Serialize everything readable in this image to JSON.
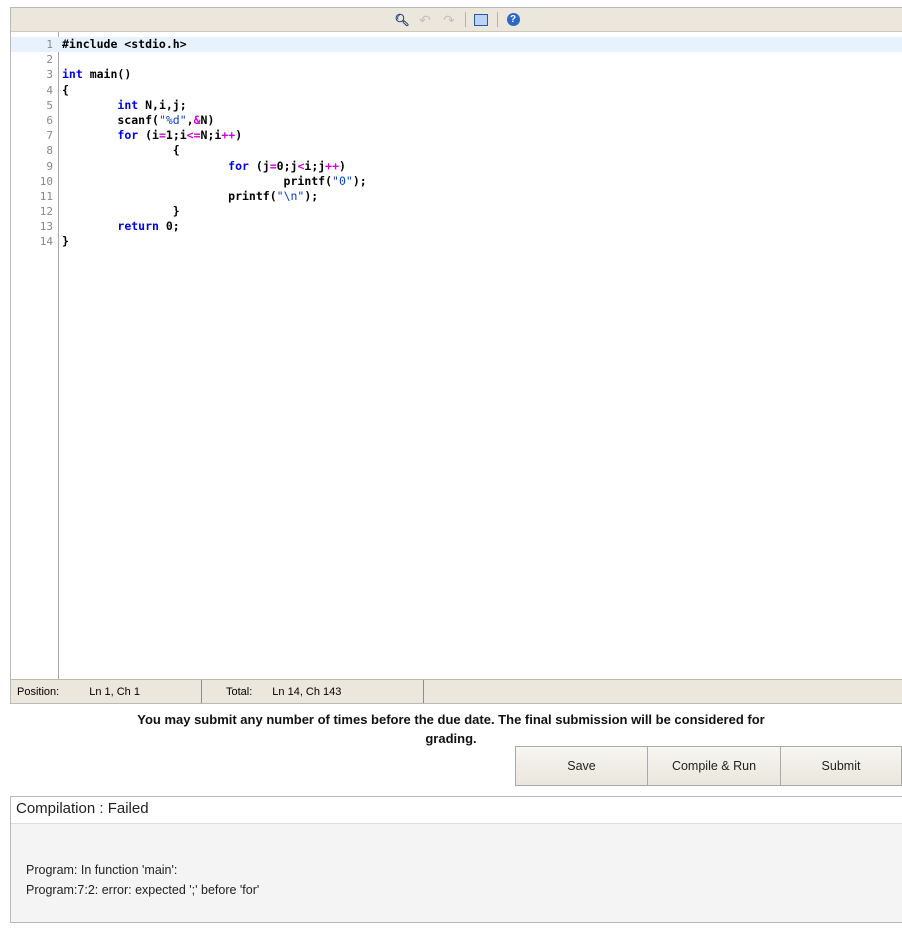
{
  "editor": {
    "toolbar": {
      "icons": [
        "find-icon",
        "undo-icon",
        "redo-icon",
        "fullscreen-icon",
        "help-icon"
      ]
    },
    "current_line": 1,
    "lines": [
      {
        "n": "1",
        "text": "#include <stdio.h>"
      },
      {
        "n": "2",
        "text": ""
      },
      {
        "n": "3",
        "text": "int main()"
      },
      {
        "n": "4",
        "text": "{"
      },
      {
        "n": "5",
        "text": "        int N,i,j;"
      },
      {
        "n": "6",
        "text": "        scanf(\"%d\",&N)"
      },
      {
        "n": "7",
        "text": "        for (i=1;i<=N;i++)"
      },
      {
        "n": "8",
        "text": "                {"
      },
      {
        "n": "9",
        "text": "                        for (j=0;j<i;j++)"
      },
      {
        "n": "10",
        "text": "                                printf(\"0\");"
      },
      {
        "n": "11",
        "text": "                        printf(\"\\n\");"
      },
      {
        "n": "12",
        "text": "                }"
      },
      {
        "n": "13",
        "text": "        return 0;"
      },
      {
        "n": "14",
        "text": "}"
      }
    ],
    "status": {
      "position_label": "Position:",
      "position_value": "Ln 1, Ch 1",
      "total_label": "Total:",
      "total_value": "Ln 14, Ch 143"
    }
  },
  "notice": {
    "line1": "You may submit any number of times before the due date. The final submission will be considered for",
    "line2": "grading."
  },
  "buttons": {
    "save": "Save",
    "compile_run": "Compile & Run",
    "submit": "Submit"
  },
  "result": {
    "heading": "Compilation : Failed",
    "messages": [
      "Program: In function 'main':",
      "Program:7:2: error: expected ';' before 'for'"
    ]
  }
}
